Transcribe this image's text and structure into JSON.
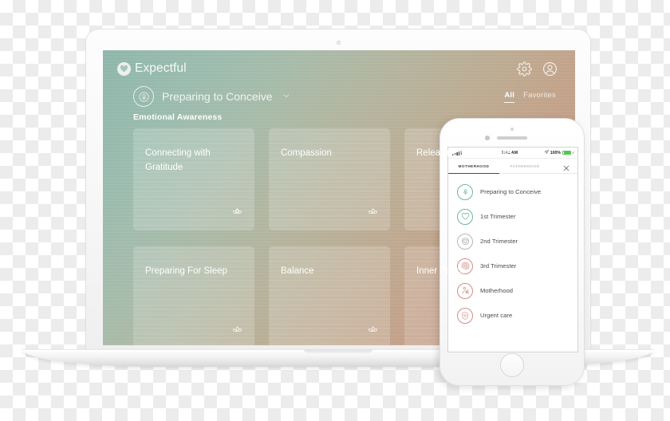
{
  "laptop": {
    "app": {
      "brand_name": "Expectful",
      "brand_icon": "heart-in-circle-logo",
      "header_icons": [
        {
          "name": "gear-icon",
          "label": "Settings"
        },
        {
          "name": "account-avatar-icon",
          "label": "Account"
        }
      ],
      "selector": {
        "icon": "seedling-circle-icon",
        "label": "Preparing to Conceive",
        "chevron": "chevron-down-icon"
      },
      "filters": [
        {
          "label": "All",
          "active": true
        },
        {
          "label": "Favorites",
          "active": false
        }
      ],
      "section_title": "Emotional Awareness",
      "cards": [
        {
          "title": "Connecting with Gratitude",
          "icon": "lotus-icon"
        },
        {
          "title": "Compassion",
          "icon": "lotus-icon"
        },
        {
          "title": "Releasing Expectations",
          "icon": "lotus-icon"
        },
        {
          "title": "Preparing For Sleep",
          "icon": "lotus-icon"
        },
        {
          "title": "Balance",
          "icon": "lotus-icon"
        },
        {
          "title": "Inner Peace",
          "icon": "lotus-icon"
        }
      ]
    }
  },
  "phone": {
    "status_bar": {
      "signal_icon": "cellular-signal-icon",
      "time": "9:41 AM",
      "location_icon": "location-arrow-icon",
      "battery_percent": "100%",
      "battery_icon": "battery-full-icon"
    },
    "tabs": [
      {
        "label": "MOTHERHOOD",
        "active": true
      },
      {
        "label": "FATHERHOOD",
        "active": false
      }
    ],
    "close_icon": "close-x-icon",
    "list": [
      {
        "label": "Preparing to Conceive",
        "icon": "seedling-circle-icon",
        "tone": "green"
      },
      {
        "label": "1st Trimester",
        "icon": "heart-circle-icon",
        "tone": "green"
      },
      {
        "label": "2nd Trimester",
        "icon": "heart-target-circle-icon",
        "tone": "gray"
      },
      {
        "label": "3rd Trimester",
        "icon": "concentric-circle-icon",
        "tone": "rose"
      },
      {
        "label": "Motherhood",
        "icon": "mother-baby-icon",
        "tone": "rose"
      },
      {
        "label": "Urgent care",
        "icon": "shield-heart-icon",
        "tone": "rose"
      }
    ]
  },
  "colors": {
    "screen_gradient_start": "#90b7ac",
    "screen_gradient_end": "#c88b84",
    "accent_green": "#6fb79c",
    "accent_rose": "#cf8f88",
    "battery_green": "#54c754"
  }
}
